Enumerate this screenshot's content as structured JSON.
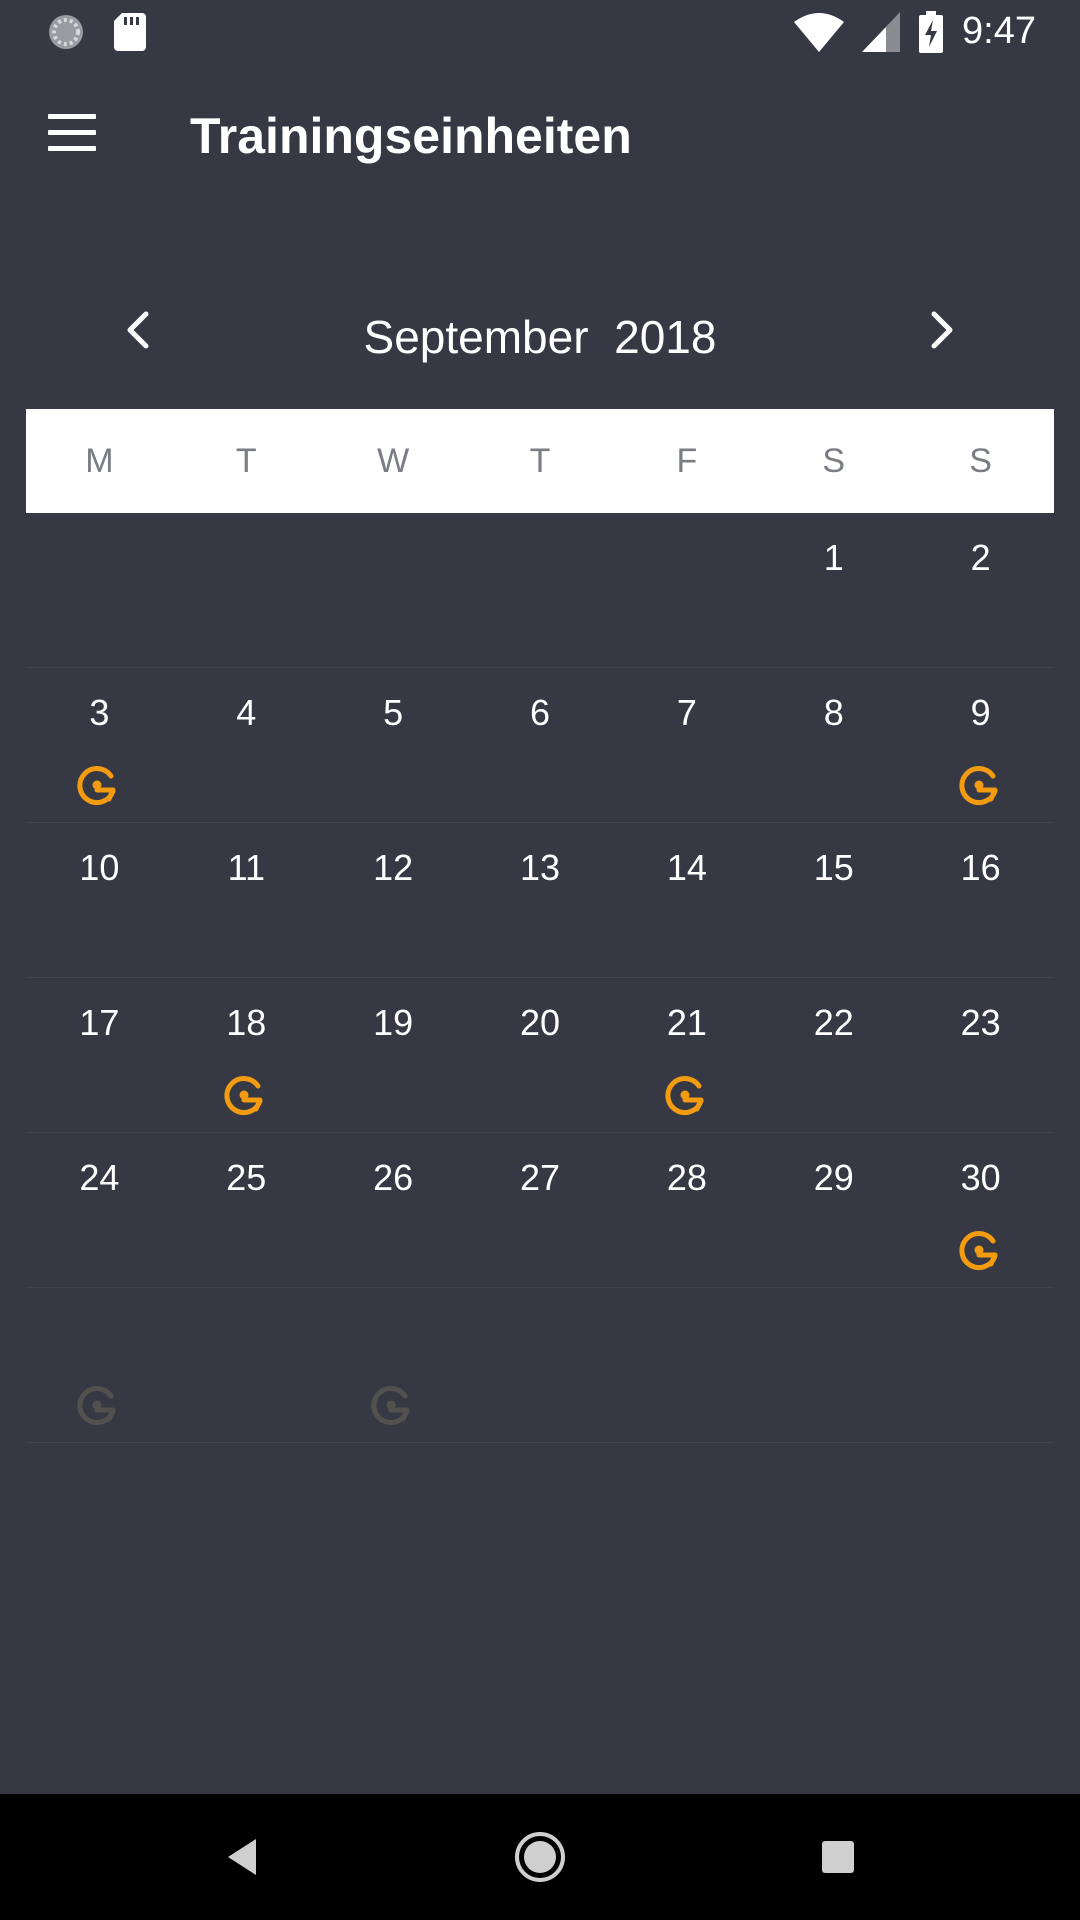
{
  "status_bar": {
    "time": "9:47",
    "icons": [
      "loading-icon",
      "sd-card-icon",
      "wifi-icon",
      "signal-icon",
      "battery-charging-icon"
    ]
  },
  "app_bar": {
    "title": "Trainingseinheiten",
    "menu_icon": "hamburger-menu-icon"
  },
  "calendar": {
    "month": "September",
    "year": "2018",
    "weekdays": [
      "M",
      "T",
      "W",
      "T",
      "F",
      "S",
      "S"
    ],
    "weeks": [
      [
        null,
        null,
        null,
        null,
        null,
        1,
        2
      ],
      [
        3,
        4,
        5,
        6,
        7,
        8,
        9
      ],
      [
        10,
        11,
        12,
        13,
        14,
        15,
        16
      ],
      [
        17,
        18,
        19,
        20,
        21,
        22,
        23
      ],
      [
        24,
        25,
        26,
        27,
        28,
        29,
        30
      ],
      [
        null,
        null,
        null,
        null,
        null,
        null,
        null
      ]
    ],
    "workout_days": [
      3,
      9,
      18,
      21,
      30
    ],
    "faded_workouts": [
      {
        "week": 5,
        "col": 0
      },
      {
        "week": 5,
        "col": 2
      }
    ],
    "accent_color": "#f39c12",
    "faded_color": "#53514e"
  },
  "nav_bar": {
    "buttons": [
      "back-icon",
      "home-icon",
      "recents-icon"
    ]
  }
}
